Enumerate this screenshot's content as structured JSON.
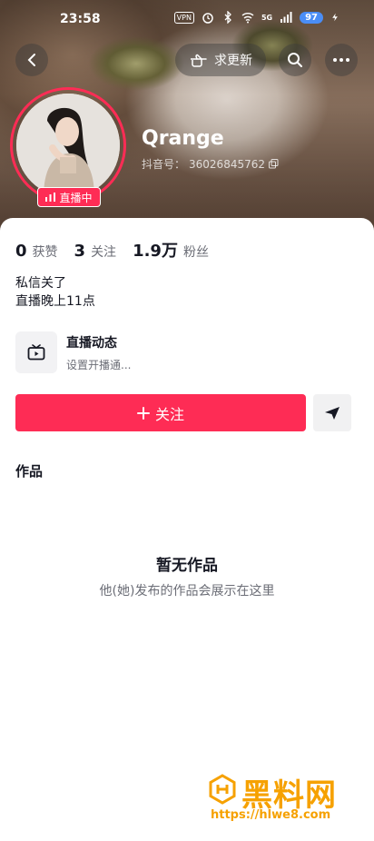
{
  "status_bar": {
    "time": "23:58",
    "vpn": "VPN",
    "network": "5G",
    "battery": "97"
  },
  "header": {
    "urge_update_label": "求更新",
    "back_icon": "chevron-left-icon",
    "search_icon": "search-icon",
    "more_icon": "more-dots-icon"
  },
  "profile": {
    "username": "Qrange",
    "douyin_id_label": "抖音号：",
    "douyin_id": "36026845762",
    "live_tag": "直播中"
  },
  "stats": [
    {
      "num": "0",
      "label": "获赞"
    },
    {
      "num": "3",
      "label": "关注"
    },
    {
      "num": "1.9万",
      "label": "粉丝"
    }
  ],
  "bio": {
    "line1": "私信关了",
    "line2": "直播晚上11点"
  },
  "live_card": {
    "title": "直播动态",
    "subtitle": "设置开播通..."
  },
  "actions": {
    "follow_label": "关注",
    "follow_icon": "plus-icon",
    "message_icon": "send-icon"
  },
  "tabs": {
    "works": "作品"
  },
  "empty_state": {
    "title": "暂无作品",
    "subtitle": "他(她)发布的作品会展示在这里"
  },
  "watermark": {
    "text": "黑料网",
    "url": "https://hlwe8.com"
  },
  "colors": {
    "accent": "#fe2c55",
    "watermark": "#f6a100",
    "battery": "#4a8df6"
  }
}
